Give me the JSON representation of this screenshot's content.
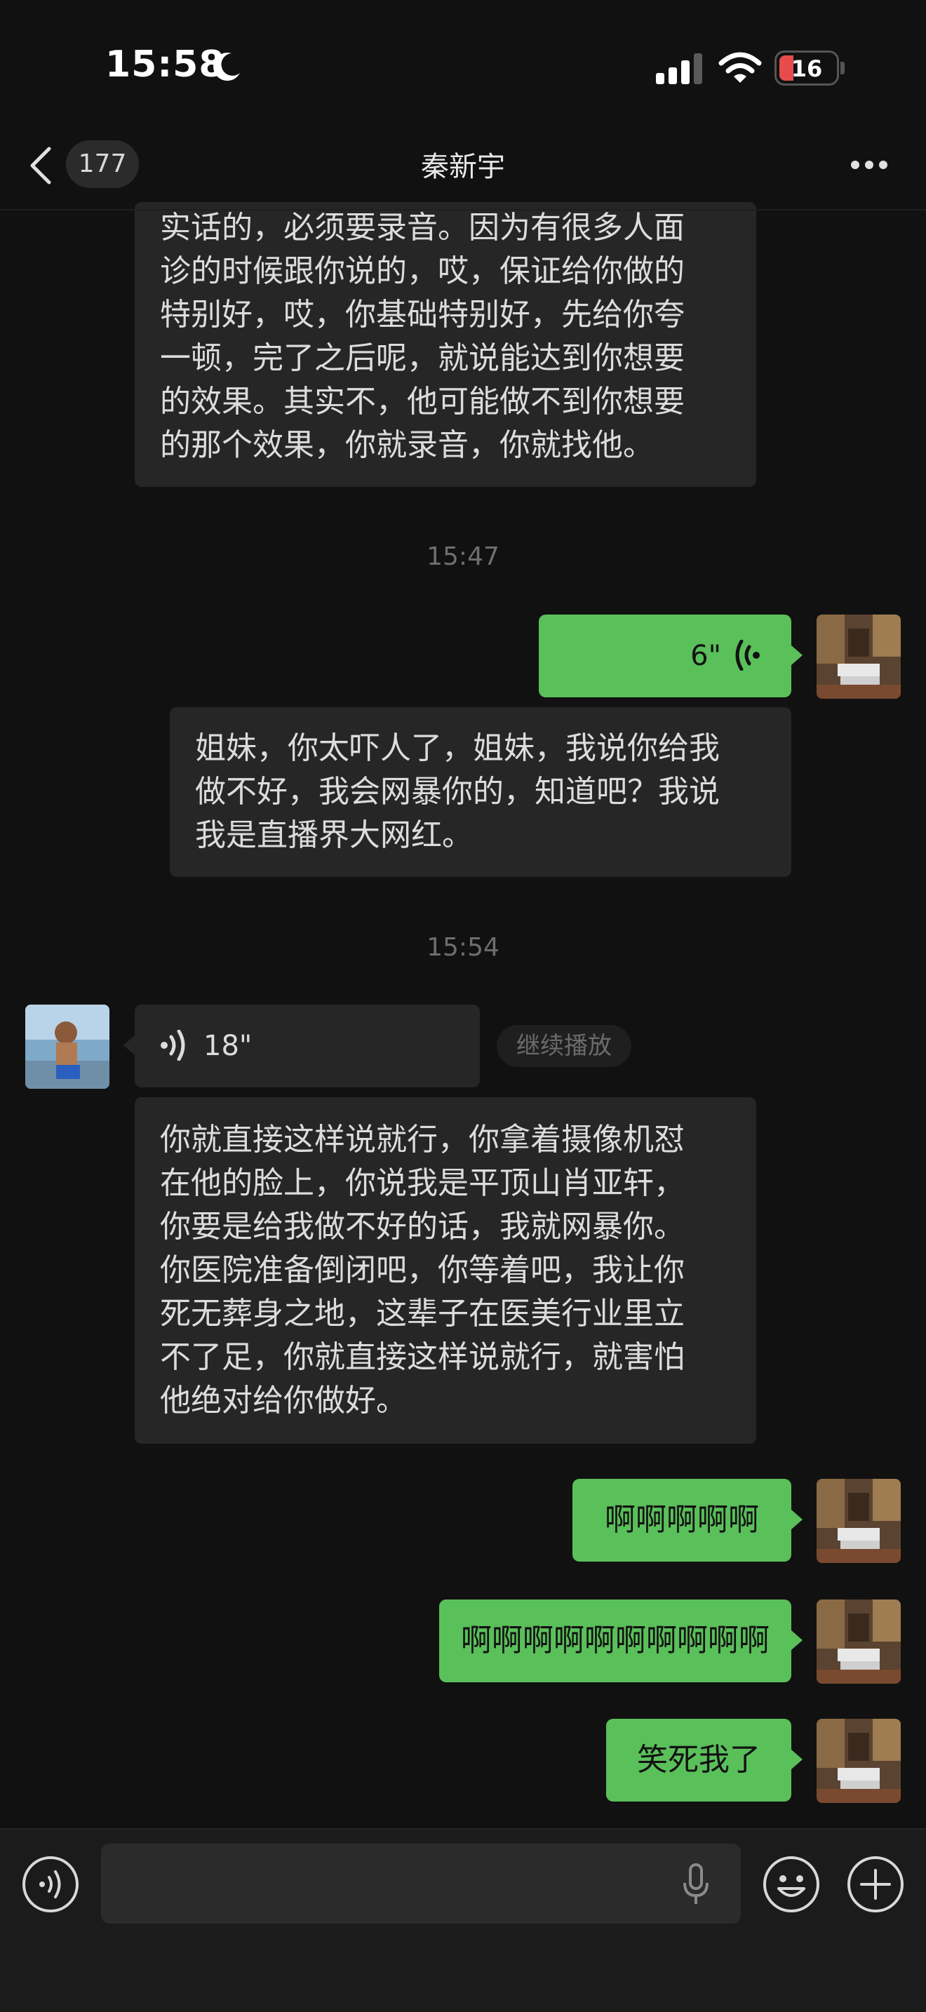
{
  "status_bar": {
    "time": "15:58",
    "battery": "16"
  },
  "nav": {
    "back_count": "177",
    "title": "秦新宇"
  },
  "messages": {
    "m1_lines": [
      "实话的，必须要录音。因为有很多人面",
      "诊的时候跟你说的，哎，保证给你做的",
      "特别好，哎，你基础特别好，先给你夸",
      "一顿，完了之后呢，就说能达到你想要",
      "的效果。其实不，他可能做不到你想要",
      "的那个效果，你就录音，你就找他。"
    ],
    "ts1": "15:47",
    "voice_out_duration": "6\"",
    "transcript1_lines": [
      "姐妹，你太吓人了，姐妹，我说你给我",
      "做不好，我会网暴你的，知道吧？我说",
      "我是直播界大网红。"
    ],
    "ts2": "15:54",
    "voice_in_duration": "18\"",
    "continue_play": "继续播放",
    "transcript2_lines": [
      "你就直接这样说就行，你拿着摄像机怼",
      "在他的脸上，你说我是平顶山肖亚轩，",
      "你要是给我做不好的话，我就网暴你。",
      "你医院准备倒闭吧，你等着吧，我让你",
      "死无葬身之地，这辈子在医美行业里立",
      "不了足，你就直接这样说就行，就害怕",
      "他绝对给你做好。"
    ],
    "m_ah1": "啊啊啊啊啊",
    "m_ah2": "啊啊啊啊啊啊啊啊啊啊",
    "m_laugh": "笑死我了"
  },
  "colors": {
    "accent_green": "#5ac05a",
    "bubble_dark": "#262626",
    "background": "#111111"
  },
  "icons": [
    "moon-icon",
    "signal-icon",
    "wifi-icon",
    "back-chevron-icon",
    "more-dots-icon",
    "voice-wave-icon",
    "voice-input-icon",
    "microphone-icon",
    "emoji-icon",
    "plus-icon"
  ]
}
